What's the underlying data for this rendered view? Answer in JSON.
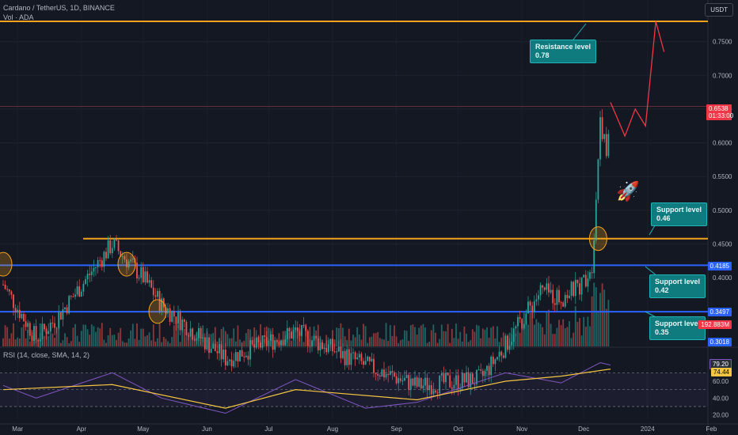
{
  "header": {
    "symbol_line": "Cardano / TetherUS, 1D, BINANCE",
    "volume_line": "Vol · ADA",
    "rsi_line": "RSI (14, close, SMA, 14, 2)",
    "currency": "USDT"
  },
  "colors": {
    "background": "#141823",
    "up": "#26a69a",
    "down": "#ef5350",
    "resistance": "#f7a21b",
    "support": "#2962ff",
    "rsi": "#7e57c2",
    "rsi_ma": "#f5c542",
    "projection": "#f23645",
    "callout": "#0f7b7e"
  },
  "callouts": [
    {
      "title": "Resistance level",
      "value": "0.78"
    },
    {
      "title": "Support level",
      "value": "0.46"
    },
    {
      "title": "Support level",
      "value": "0.42"
    },
    {
      "title": "Support level",
      "value": "0.35"
    }
  ],
  "price_tags": {
    "last": "0.6538",
    "countdown": "01:33:00",
    "support_high": "0.4185",
    "support_mid": "0.3497",
    "volume": "192.883M",
    "low": "0.3018",
    "rsi": "79.20",
    "rsi_ma": "74.44"
  },
  "chart_data": [
    {
      "type": "candlestick",
      "name": "ADA/USDT daily",
      "ylim": [
        0.3,
        0.8
      ],
      "y_ticks": [
        "0.7500",
        "0.7000",
        "0.6500",
        "0.6000",
        "0.5500",
        "0.5000",
        "0.4500",
        "0.4000",
        "0.3500"
      ],
      "x_ticks": [
        "Mar",
        "Apr",
        "May",
        "Jun",
        "Jul",
        "Aug",
        "Sep",
        "Oct",
        "Nov",
        "Dec",
        "2024",
        "Feb"
      ],
      "levels": [
        {
          "kind": "resistance",
          "value": 0.78
        },
        {
          "kind": "support",
          "value": 0.458
        },
        {
          "kind": "support",
          "value": 0.4185
        },
        {
          "kind": "support",
          "value": 0.3497
        }
      ],
      "last_price": 0.6538,
      "key_points": [
        {
          "date": "Feb 22",
          "price": 0.39
        },
        {
          "date": "Mar 10",
          "price": 0.31
        },
        {
          "date": "Mar 20",
          "price": 0.34
        },
        {
          "date": "Apr 16",
          "price": 0.45
        },
        {
          "date": "May 01",
          "price": 0.4
        },
        {
          "date": "May 10",
          "price": 0.36
        },
        {
          "date": "Jun 10",
          "price": 0.28
        },
        {
          "date": "Jul 14",
          "price": 0.32
        },
        {
          "date": "Aug 17",
          "price": 0.27
        },
        {
          "date": "Sep 11",
          "price": 0.24
        },
        {
          "date": "Oct 12",
          "price": 0.25
        },
        {
          "date": "Oct 24",
          "price": 0.3
        },
        {
          "date": "Nov 10",
          "price": 0.38
        },
        {
          "date": "Nov 20",
          "price": 0.37
        },
        {
          "date": "Nov 30",
          "price": 0.39
        },
        {
          "date": "Dec 05",
          "price": 0.42
        },
        {
          "date": "Dec 07",
          "price": 0.52
        },
        {
          "date": "Dec 09",
          "price": 0.64
        },
        {
          "date": "Dec 12",
          "price": 0.58
        },
        {
          "date": "Dec 14",
          "price": 0.6538
        }
      ],
      "projection": [
        {
          "date": "Dec 14",
          "price": 0.66
        },
        {
          "date": "Dec 21",
          "price": 0.61
        },
        {
          "date": "Dec 26",
          "price": 0.65
        },
        {
          "date": "Dec 31",
          "price": 0.625
        },
        {
          "date": "Jan 05",
          "price": 0.78
        },
        {
          "date": "Jan 09",
          "price": 0.735
        }
      ]
    },
    {
      "type": "line",
      "name": "RSI",
      "ylim": [
        15,
        90
      ],
      "y_ticks": [
        "60.00",
        "40.00",
        "20.00"
      ],
      "bands": [
        70,
        50,
        30
      ],
      "rsi": [
        {
          "date": "Feb 22",
          "value": 55
        },
        {
          "date": "Mar 10",
          "value": 40
        },
        {
          "date": "Apr 16",
          "value": 70
        },
        {
          "date": "May 10",
          "value": 40
        },
        {
          "date": "Jun 10",
          "value": 22
        },
        {
          "date": "Jul 14",
          "value": 62
        },
        {
          "date": "Aug 17",
          "value": 28
        },
        {
          "date": "Sep 11",
          "value": 35
        },
        {
          "date": "Oct 24",
          "value": 70
        },
        {
          "date": "Nov 20",
          "value": 58
        },
        {
          "date": "Dec 09",
          "value": 82
        },
        {
          "date": "Dec 14",
          "value": 79.2
        }
      ],
      "rsi_ma": [
        {
          "date": "Feb 22",
          "value": 50
        },
        {
          "date": "Apr 16",
          "value": 56
        },
        {
          "date": "Jun 10",
          "value": 28
        },
        {
          "date": "Jul 14",
          "value": 50
        },
        {
          "date": "Sep 11",
          "value": 38
        },
        {
          "date": "Oct 24",
          "value": 60
        },
        {
          "date": "Nov 20",
          "value": 66
        },
        {
          "date": "Dec 14",
          "value": 74.44
        }
      ]
    }
  ]
}
